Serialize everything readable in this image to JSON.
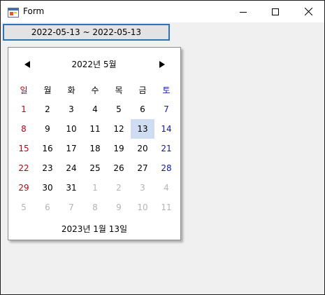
{
  "window": {
    "title": "Form"
  },
  "range_text": "2022-05-13 ~ 2022-05-13",
  "calendar": {
    "month_title": "2022년 5월",
    "weekdays": [
      "일",
      "월",
      "화",
      "수",
      "목",
      "금",
      "토"
    ],
    "weeks": [
      [
        {
          "d": "1",
          "t": "sun"
        },
        {
          "d": "2",
          "t": ""
        },
        {
          "d": "3",
          "t": ""
        },
        {
          "d": "4",
          "t": ""
        },
        {
          "d": "5",
          "t": ""
        },
        {
          "d": "6",
          "t": ""
        },
        {
          "d": "7",
          "t": "sat"
        }
      ],
      [
        {
          "d": "8",
          "t": "sun"
        },
        {
          "d": "9",
          "t": ""
        },
        {
          "d": "10",
          "t": ""
        },
        {
          "d": "11",
          "t": ""
        },
        {
          "d": "12",
          "t": ""
        },
        {
          "d": "13",
          "t": "selected"
        },
        {
          "d": "14",
          "t": "sat"
        }
      ],
      [
        {
          "d": "15",
          "t": "sun"
        },
        {
          "d": "16",
          "t": ""
        },
        {
          "d": "17",
          "t": ""
        },
        {
          "d": "18",
          "t": ""
        },
        {
          "d": "19",
          "t": ""
        },
        {
          "d": "20",
          "t": ""
        },
        {
          "d": "21",
          "t": "sat"
        }
      ],
      [
        {
          "d": "22",
          "t": "sun"
        },
        {
          "d": "23",
          "t": ""
        },
        {
          "d": "24",
          "t": ""
        },
        {
          "d": "25",
          "t": ""
        },
        {
          "d": "26",
          "t": ""
        },
        {
          "d": "27",
          "t": ""
        },
        {
          "d": "28",
          "t": "sat"
        }
      ],
      [
        {
          "d": "29",
          "t": "sun"
        },
        {
          "d": "30",
          "t": ""
        },
        {
          "d": "31",
          "t": ""
        },
        {
          "d": "1",
          "t": "other"
        },
        {
          "d": "2",
          "t": "other"
        },
        {
          "d": "3",
          "t": "other"
        },
        {
          "d": "4",
          "t": "other"
        }
      ],
      [
        {
          "d": "5",
          "t": "other"
        },
        {
          "d": "6",
          "t": "other"
        },
        {
          "d": "7",
          "t": "other"
        },
        {
          "d": "8",
          "t": "other"
        },
        {
          "d": "9",
          "t": "other"
        },
        {
          "d": "10",
          "t": "other"
        },
        {
          "d": "11",
          "t": "other"
        }
      ]
    ],
    "today_text": "2023년 1월 13일"
  },
  "colors": {
    "sunday": "#c0000f",
    "saturday": "#1017a8",
    "other_month": "#b4b4b4",
    "selected_bg": "#cfddf3",
    "focus_border": "#2e73b8"
  },
  "icons": {
    "app": "winforms-app-icon",
    "minimize": "minimize-icon",
    "maximize": "maximize-icon",
    "close": "close-icon",
    "prev": "triangle-left-icon",
    "next": "triangle-right-icon"
  }
}
